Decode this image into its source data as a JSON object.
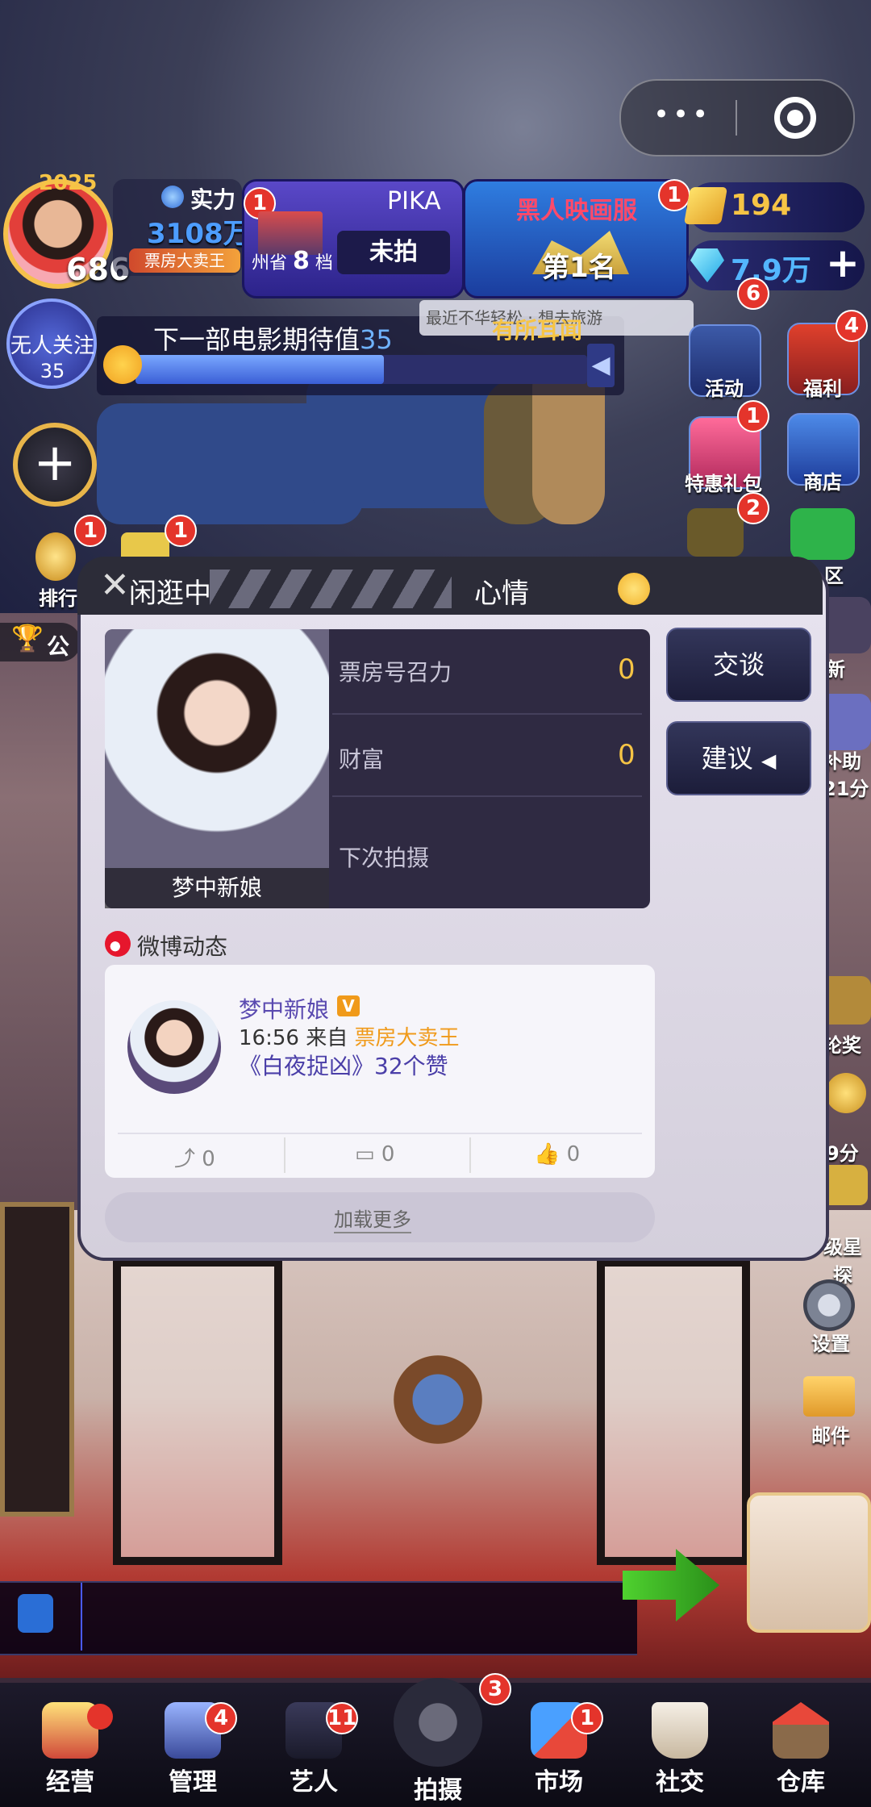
{
  "player": {
    "year": "2025",
    "level": "686",
    "power_label": "实力",
    "power_value": "3108万",
    "title_badge": "票房大卖王",
    "avatar_badge": "1"
  },
  "studio": {
    "name": "PIKA",
    "location_prefix": "州省",
    "tier_number": "8",
    "tier_suffix": "档",
    "status": "未拍"
  },
  "ranking": {
    "title": "黑人映画服",
    "rank": "第1名",
    "badge": "1"
  },
  "currency": {
    "tickets": "194",
    "diamonds": "7.9万",
    "add_label": "+"
  },
  "fans": {
    "label": "无人关注",
    "value": "35"
  },
  "expectation": {
    "label": "下一部电影期待值",
    "value": "35",
    "progress": 0.55,
    "rumor": "有所耳闻"
  },
  "marquee": "最近不华轻松 · 想去旅游",
  "side_right": [
    {
      "label": "活动",
      "badge": "6"
    },
    {
      "label": "福利",
      "badge": "4"
    },
    {
      "label": "特惠礼包",
      "badge": "1"
    },
    {
      "label": "商店",
      "badge": ""
    },
    {
      "label": "",
      "badge": "2"
    }
  ],
  "side_left": {
    "rank_label": "排行",
    "rank_badge": "1",
    "second_badge": "1",
    "notice": "公"
  },
  "edge_labels": [
    "区",
    "新",
    "补助",
    "21分",
    "轮奖",
    "9分",
    "级星探"
  ],
  "settings_label": "设置",
  "mail_label": "邮件",
  "modal": {
    "status": "闲逛中",
    "mood_label": "心情",
    "character_name": "梦中新娘",
    "stats": [
      {
        "label": "票房号召力",
        "value": "0"
      },
      {
        "label": "财富",
        "value": "0"
      },
      {
        "label": "下次拍摄",
        "value": ""
      }
    ],
    "talk_button": "交谈",
    "suggest_button": "建议",
    "weibo_title": "微博动态",
    "post": {
      "author": "梦中新娘",
      "verified": "V",
      "time": "16:56",
      "from_text": "来自",
      "source": "票房大卖王",
      "content": "《白夜捉凶》32个赞",
      "shares": "0",
      "comments": "0",
      "likes": "0"
    },
    "load_more": "加载更多"
  },
  "bottom_nav": [
    {
      "label": "经营",
      "badge": "",
      "dot": true
    },
    {
      "label": "管理",
      "badge": "4"
    },
    {
      "label": "艺人",
      "badge": "11"
    },
    {
      "label": "拍摄",
      "badge": "3"
    },
    {
      "label": "市场",
      "badge": "1"
    },
    {
      "label": "社交",
      "badge": ""
    },
    {
      "label": "仓库",
      "badge": ""
    }
  ]
}
